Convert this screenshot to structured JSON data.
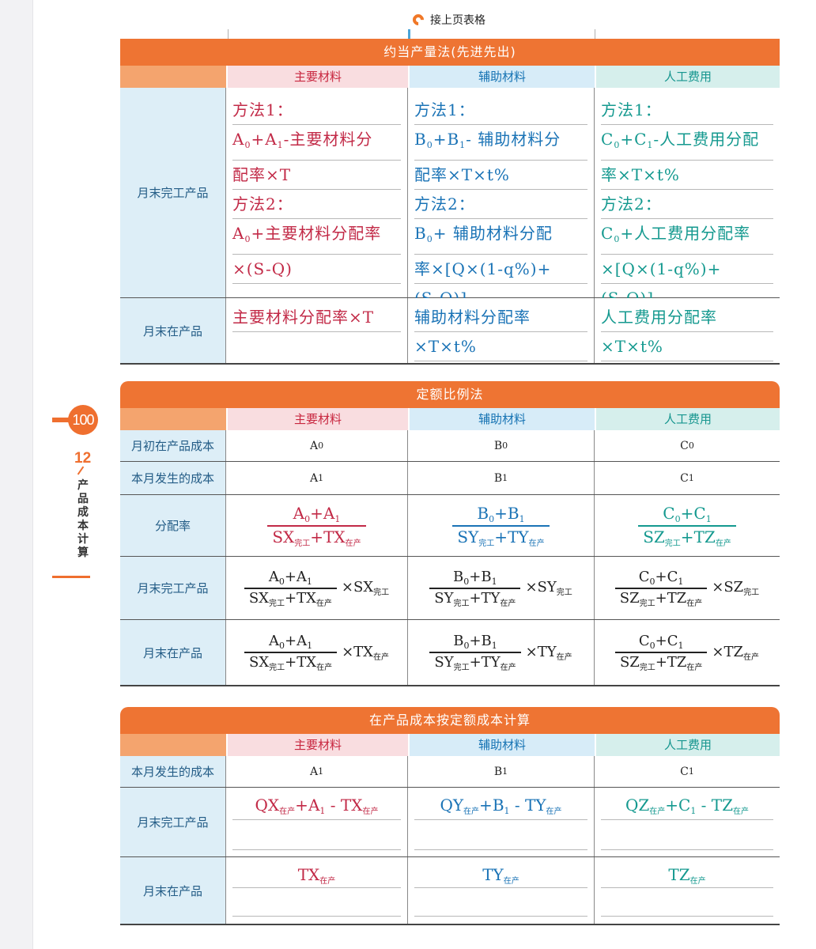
{
  "page": {
    "number": "100",
    "chapter_num": "12",
    "chapter_title": "产品成本计算",
    "continued_note": "接上页表格"
  },
  "col_headers": [
    "主要材料",
    "辅助材料",
    "人工费用"
  ],
  "colors": {
    "header": "#ee7433",
    "label_bg": "#ddeef7",
    "red": "#c22a47",
    "blue": "#1a73b6",
    "teal": "#14998f"
  },
  "table1": {
    "title": "约当产量法(先进先出)",
    "row_labels": [
      "月末完工产品",
      "月末在产品"
    ]
  },
  "table2": {
    "title": "定额比例法",
    "row_labels": [
      "月初在产品成本",
      "本月发生的成本",
      "分配率",
      "月末完工产品",
      "月末在产品"
    ]
  },
  "table3": {
    "title": "在产品成本按定额成本计算",
    "row_labels": [
      "本月发生的成本",
      "月末完工产品",
      "月末在产品"
    ]
  },
  "math": {
    "method1": "方法1：",
    "method2": "方法2：",
    "A": "A",
    "B": "B",
    "C": "C",
    "sub0": "0",
    "sub1": "1",
    "done": "完工",
    "inprog": "在产",
    "t1_r1_c1_l2": "+主要材料分",
    "t1_r1_c1_l3": "配率×T",
    "t1_r1_c1_l5": "+主要材料分配率",
    "t1_r1_c1_l6": "×(S-Q)",
    "t1_r1_c2_l2": "- 辅助材料分",
    "t1_r1_c2_l3": "配率×T×t%",
    "t1_r1_c2_l5": "+ 辅助材料分配",
    "t1_r1_c2_l6": "率×[Q×(1-q%)+",
    "t1_r1_c2_l7": "(S-Q)]",
    "t1_r1_c3_l2": "-人工费用分配",
    "t1_r1_c3_l3": "率×T×t%",
    "t1_r1_c3_l5": "+人工费用分配率",
    "t1_r1_c3_l6": "×[Q×(1-q%)+",
    "t1_r1_c3_l7": "(S-Q)]",
    "t1_r2_c1": "主要材料分配率×T",
    "t1_r2_c2_l1": "辅助材料分配率",
    "t1_r2_c2_l2": "×T×t%",
    "t1_r2_c3_l1": "人工费用分配率",
    "t1_r2_c3_l2": "×T×t%",
    "SX": "SX",
    "TX": "TX",
    "SY": "SY",
    "TY": "TY",
    "SZ": "SZ",
    "TZ": "TZ",
    "QX": "QX",
    "QY": "QY",
    "QZ": "QZ",
    "plus": "+",
    "minus": " - ",
    "times": "×"
  }
}
